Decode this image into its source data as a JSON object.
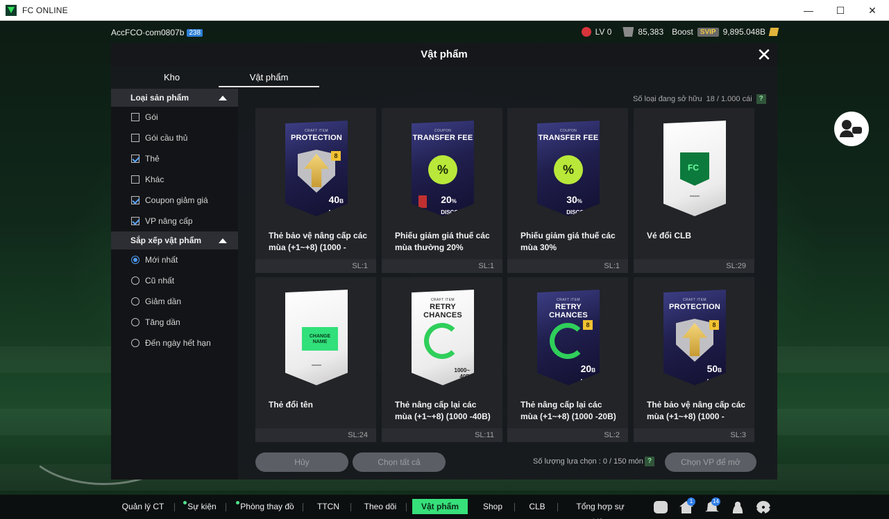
{
  "window": {
    "title": "FC ONLINE",
    "minimize": "—",
    "maximize": "☐",
    "close": "✕"
  },
  "hud": {
    "account": "AccFCO·com0807b",
    "account_badge": "238",
    "level": "LV 0",
    "coins": "85,383",
    "boost_label": "Boost",
    "svip_label": "SVIP",
    "bp": "9,895.048B"
  },
  "modal": {
    "title": "Vật phẩm",
    "close": "✕",
    "tabs": [
      {
        "label": "Kho"
      },
      {
        "label": "Vật phẩm"
      }
    ],
    "owned_label": "Số loại đang sở hữu",
    "owned_value": "18 / 1.000 cái",
    "help": "?"
  },
  "sidebar": {
    "product_type": {
      "title": "Loại sản phẩm",
      "options": [
        {
          "label": "Gói",
          "checked": false
        },
        {
          "label": "Gói cầu thủ",
          "checked": false
        },
        {
          "label": "Thẻ",
          "checked": true
        },
        {
          "label": "Khác",
          "checked": false
        },
        {
          "label": "Coupon giảm giá",
          "checked": true
        },
        {
          "label": "VP nâng cấp",
          "checked": true
        }
      ]
    },
    "sort": {
      "title": "Sắp xếp vật phẩm",
      "options": [
        {
          "label": "Mới nhất",
          "selected": true
        },
        {
          "label": "Cũ nhất",
          "selected": false
        },
        {
          "label": "Giảm dần",
          "selected": false
        },
        {
          "label": "Tăng dần",
          "selected": false
        },
        {
          "label": "Đến ngày hết hạn",
          "selected": false
        }
      ]
    }
  },
  "items": [
    {
      "name": "Thẻ bảo vệ nâng cấp các mùa (+1~+8) (1000 -",
      "qty": "SL:1",
      "art_top": "CRAFT ITEM",
      "art_label": "PROTECTION",
      "art_value": "40",
      "art_unit": "B",
      "art_sub": "MAX",
      "badge": "8"
    },
    {
      "name": "Phiếu giảm giá thuế các mùa thường 20%",
      "qty": "SL:1",
      "art_top": "COUPON",
      "art_label": "TRANSFER FEE",
      "art_value": "20",
      "art_unit": "%",
      "art_sub": "DISCOUNT",
      "pct": "%"
    },
    {
      "name": "Phiếu giảm giá thuế các mùa 30%",
      "qty": "SL:1",
      "art_top": "COUPON",
      "art_label": "TRANSFER FEE",
      "art_value": "30",
      "art_unit": "%",
      "art_sub": "DISCOUNT",
      "pct": "%"
    },
    {
      "name": "Vé đổi CLB",
      "qty": "SL:29"
    },
    {
      "name": "Thẻ đổi tên",
      "qty": "SL:24",
      "tag": "CHANGE NAME"
    },
    {
      "name": "Thẻ nâng cấp lại các mùa (+1~+8) (1000 -40B)",
      "qty": "SL:11",
      "art_top": "CRAFT ITEM",
      "art_label": "RETRY CHANCES",
      "art_value": "1000~ 40B"
    },
    {
      "name": "Thẻ nâng cấp lại các mùa (+1~+8) (1000 -20B)",
      "qty": "SL:2",
      "art_top": "CRAFT ITEM",
      "art_label": "RETRY CHANCES",
      "art_value": "20",
      "art_unit": "B",
      "art_sub": "MAX",
      "badge": "8"
    },
    {
      "name": "Thẻ bảo vệ nâng cấp các mùa (+1~+8) (1000 -",
      "qty": "SL:3",
      "art_top": "CRAFT ITEM",
      "art_label": "PROTECTION",
      "art_value": "50",
      "art_unit": "B",
      "art_sub": "MAX",
      "badge": "8"
    }
  ],
  "actions": {
    "cancel": "Hủy",
    "select_all": "Chọn tất cả",
    "selected_count": "Số lượng lựa chọn : 0 / 150 món",
    "open": "Chọn VP để mở"
  },
  "nav": {
    "items": [
      {
        "label": "Quản lý CT"
      },
      {
        "label": "Sự kiện"
      },
      {
        "label": "Phòng thay đồ"
      },
      {
        "label": "TTCN"
      },
      {
        "label": "Theo dõi"
      },
      {
        "label": "Vật phẩm"
      },
      {
        "label": "Shop"
      },
      {
        "label": "CLB"
      },
      {
        "label": "Tổng hợp sự kiện"
      }
    ],
    "home_badge": "1",
    "bell_badge": "14",
    "accent": "#36e07a"
  }
}
